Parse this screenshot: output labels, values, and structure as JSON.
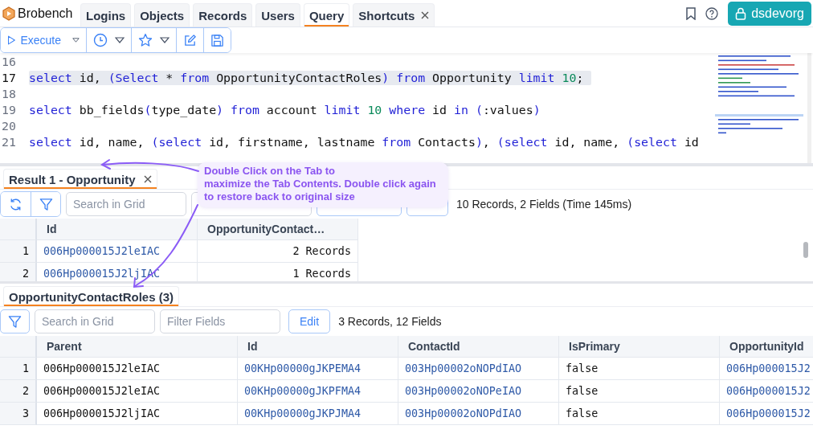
{
  "app": {
    "name": "Brobench"
  },
  "nav_tabs": [
    {
      "label": "Logins",
      "selected": false,
      "closable": false
    },
    {
      "label": "Objects",
      "selected": false,
      "closable": false
    },
    {
      "label": "Records",
      "selected": false,
      "closable": false
    },
    {
      "label": "Users",
      "selected": false,
      "closable": false
    },
    {
      "label": "Query",
      "selected": true,
      "closable": false
    },
    {
      "label": "Shortcuts",
      "selected": false,
      "closable": true
    }
  ],
  "org_button": {
    "label": "dsdevorg"
  },
  "toolbar": {
    "execute": {
      "label": "Execute"
    }
  },
  "editor": {
    "lines": [
      {
        "number": "16",
        "highlighted": false
      },
      {
        "number": "17",
        "highlighted": true,
        "tokens": [
          {
            "text": "select",
            "kind": "keyword"
          },
          {
            "text": " id, ",
            "kind": "plain"
          },
          {
            "text": "(",
            "kind": "keyword"
          },
          {
            "text": "Select",
            "kind": "keyword"
          },
          {
            "text": " * ",
            "kind": "plain"
          },
          {
            "text": "from",
            "kind": "keyword"
          },
          {
            "text": " OpportunityContactRoles",
            "kind": "plain"
          },
          {
            "text": ")",
            "kind": "keyword"
          },
          {
            "text": " from",
            "kind": "keyword"
          },
          {
            "text": " Opportunity ",
            "kind": "plain"
          },
          {
            "text": "limit",
            "kind": "keyword"
          },
          {
            "text": " 10",
            "kind": "number"
          },
          {
            "text": ";",
            "kind": "plain"
          }
        ]
      },
      {
        "number": "18",
        "highlighted": false
      },
      {
        "number": "19",
        "highlighted": false,
        "tokens": [
          {
            "text": "select",
            "kind": "keyword"
          },
          {
            "text": " bb_fields",
            "kind": "plain"
          },
          {
            "text": "(",
            "kind": "keyword"
          },
          {
            "text": "type_date",
            "kind": "plain"
          },
          {
            "text": ")",
            "kind": "keyword"
          },
          {
            "text": " from",
            "kind": "keyword"
          },
          {
            "text": " account ",
            "kind": "plain"
          },
          {
            "text": "limit",
            "kind": "keyword"
          },
          {
            "text": " 10",
            "kind": "number"
          },
          {
            "text": " where",
            "kind": "keyword"
          },
          {
            "text": " id ",
            "kind": "plain"
          },
          {
            "text": "in",
            "kind": "keyword"
          },
          {
            "text": " (",
            "kind": "keyword"
          },
          {
            "text": ":values",
            "kind": "plain"
          },
          {
            "text": ")",
            "kind": "keyword"
          }
        ]
      },
      {
        "number": "20",
        "highlighted": false
      },
      {
        "number": "21",
        "highlighted": false,
        "tokens": [
          {
            "text": "select",
            "kind": "keyword"
          },
          {
            "text": " id, name, ",
            "kind": "plain"
          },
          {
            "text": "(",
            "kind": "keyword"
          },
          {
            "text": "select",
            "kind": "keyword"
          },
          {
            "text": " id, firstname, lastname ",
            "kind": "plain"
          },
          {
            "text": "from",
            "kind": "keyword"
          },
          {
            "text": " Contacts",
            "kind": "plain"
          },
          {
            "text": ")",
            "kind": "keyword"
          },
          {
            "text": ", ",
            "kind": "plain"
          },
          {
            "text": "(",
            "kind": "keyword"
          },
          {
            "text": "select",
            "kind": "keyword"
          },
          {
            "text": " id, name, ",
            "kind": "plain"
          },
          {
            "text": "(",
            "kind": "keyword"
          },
          {
            "text": "select",
            "kind": "keyword"
          },
          {
            "text": " id",
            "kind": "plain"
          }
        ]
      }
    ]
  },
  "result_panel": {
    "tab": {
      "label": "Result 1 - Opportunity",
      "selected": true,
      "closable": true
    },
    "search": {
      "placeholder": "Search in Grid"
    },
    "summary": "10 Records, 2 Fields (Time 145ms)",
    "columns": [
      {
        "label": "Id",
        "kind": "link"
      },
      {
        "label": "OpportunityContact…",
        "kind": "count"
      }
    ],
    "rows": [
      {
        "number": "1",
        "cells": [
          "006Hp000015J2leIAC",
          "2 Records"
        ]
      },
      {
        "number": "2",
        "cells": [
          "006Hp000015J2ljIAC",
          "1 Records"
        ]
      }
    ]
  },
  "tooltip": {
    "lines": [
      "Double Click on the Tab to",
      "maximize the Tab Contents. Double click again",
      "to restore back to original size"
    ]
  },
  "child_panel": {
    "tab": {
      "label": "OpportunityContactRoles (3)",
      "selected": true
    },
    "search": {
      "placeholder": "Search in Grid"
    },
    "filter": {
      "placeholder": "Filter Fields"
    },
    "edit_button": "Edit",
    "summary": "3 Records, 12 Fields",
    "columns": [
      {
        "label": "Parent",
        "kind": "text"
      },
      {
        "label": "Id",
        "kind": "link"
      },
      {
        "label": "ContactId",
        "kind": "link"
      },
      {
        "label": "IsPrimary",
        "kind": "text"
      },
      {
        "label": "OpportunityId",
        "kind": "link"
      }
    ],
    "rows": [
      {
        "number": "1",
        "cells": [
          "006Hp000015J2leIAC",
          "00KHp00000gJKPEMA4",
          "003Hp00002oNOPdIAO",
          "false",
          "006Hp000015J2"
        ]
      },
      {
        "number": "2",
        "cells": [
          "006Hp000015J2leIAC",
          "00KHp00000gJKPFMA4",
          "003Hp00002oNOPeIAO",
          "false",
          "006Hp000015J2"
        ]
      },
      {
        "number": "3",
        "cells": [
          "006Hp000015J2ljIAC",
          "00KHp00000gJKPJMA4",
          "003Hp00002oNOPdIAO",
          "false",
          "006Hp000015J2"
        ]
      }
    ]
  }
}
